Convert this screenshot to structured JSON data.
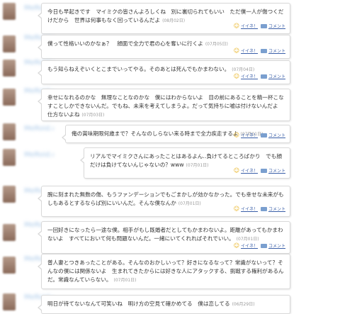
{
  "ui": {
    "like_label": "イイネ！",
    "comment_label": "コメント"
  },
  "posts": [
    {
      "username": "MeRoid.d",
      "text": "今日も早起きです　マイミクの皆さんよろしくね　別に裏切られてもいい　ただ僕一人が傷つくだけだから　世界は何事もなく回っているんだよ",
      "date": "(08月02日)"
    },
    {
      "username": "MeRoid.d",
      "text": "僕って性格いいのかなぁ？　顔面で全力で君の心を奪いに行くよ",
      "date": "(07月05日)"
    },
    {
      "username": "MeRoid.d",
      "text": "もう知らねえぞいくとこまでいってやる。そのあとは死んでもかまわない。",
      "date": "(07月04日)"
    },
    {
      "username": "MeRoid.d",
      "text": "幸せになれるのかな　無理なことなのかな　僕にはわからないよ　目の前にあることを精一杯こなすことしかできないんだ。でもね、未来を考えてしまうよ。だって気持ちに嘘は付けないんだよ　仕方ないよね",
      "date": "(07月03日)"
    },
    {
      "username": "MeRoid.d",
      "text": "俺の賞味期限何歳まで？そんなのしらない来る時まで全力疾走するよ",
      "date": "(07月01日)"
    },
    {
      "username": "MeRoid.d",
      "text": "リアルでマイミクさんにあったことはあるよん‥負けてるところばかり　でも顔だけは負けてないんじゃないの？www",
      "date": "(07月01日)"
    },
    {
      "username": "MeRoid.d",
      "text": "腕に刻まれた無数の傷、もうファンデーションでもごまかしが効かなかった。でも幸せな未来がもしもあるとするならば別にいいんだ。そんな僕なんか",
      "date": "(07月01日)"
    },
    {
      "username": "MeRoid.d",
      "text": "一回好きになったら一途な僕。相手がもし既婚者だとしてもかまわないよ。距離があってもかまわないよ　すべてにおいて何も問題ないんだ。一緒にいてくれればそれでいい。",
      "date": "(07月01日)"
    },
    {
      "username": "MeRoid.d",
      "text": "普人妻とつきあったことがある。そんなのおかしいって？好きになるなって？常識がないって？そんなの僕には関係ないよ　生まれてきたからには好きな人にアタックする、挑戦する権利があるんだ。常識なんていらない。",
      "date": "(07月01日)"
    },
    {
      "username": "MeRoid.d",
      "text": "明日が待てないなんて可笑いね　明け方の空見て確かめてる　僕は恋してる",
      "date": "(06月29日)"
    }
  ]
}
